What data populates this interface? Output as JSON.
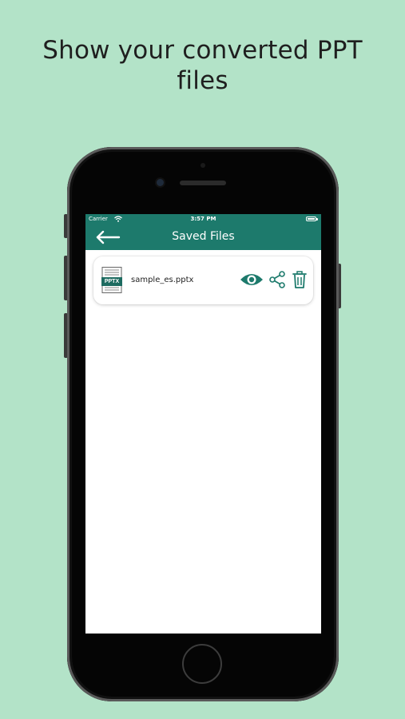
{
  "headline": {
    "line1": "Show your converted PPT",
    "line2": "files"
  },
  "status_bar": {
    "carrier": "Carrier",
    "time": "3:57 PM"
  },
  "appbar": {
    "title": "Saved Files",
    "back_icon": "arrow-left-icon"
  },
  "files": [
    {
      "name": "sample_es.pptx",
      "type_label": "PPTX",
      "actions": [
        "eye-icon",
        "share-icon",
        "trash-icon"
      ]
    }
  ],
  "colors": {
    "background": "#b3e3c8",
    "appbar": "#1d7a6c",
    "accent": "#1d7a6c"
  }
}
